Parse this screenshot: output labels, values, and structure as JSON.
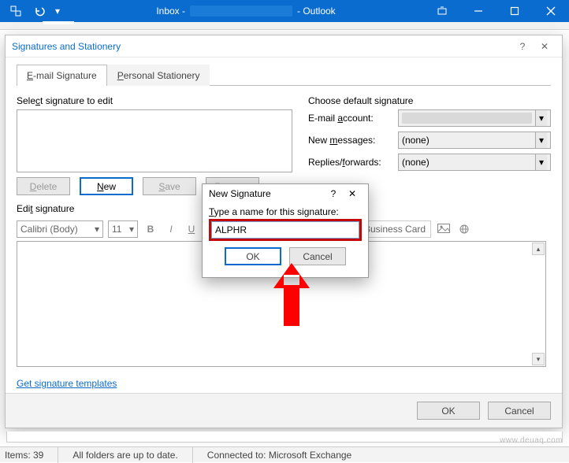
{
  "window": {
    "title_inbox": "Inbox -",
    "title_app": "- Outlook"
  },
  "dialog": {
    "title": "Signatures and Stationery",
    "tabs": {
      "email": "E-mail Signature",
      "stationery": "Personal Stationery"
    },
    "left": {
      "select_label": "Select signature to edit",
      "buttons": {
        "delete": "Delete",
        "new": "New",
        "save": "Save",
        "rename": "Rename"
      }
    },
    "right": {
      "header": "Choose default signature",
      "account_label": "E-mail account:",
      "new_msg_label": "New messages:",
      "new_msg_value": "(none)",
      "replies_label": "Replies/forwards:",
      "replies_value": "(none)"
    },
    "edit_label": "Edit signature",
    "toolbar": {
      "font": "Calibri (Body)",
      "size": "11",
      "business_card": "Business Card"
    },
    "link": "Get signature templates",
    "footer": {
      "ok": "OK",
      "cancel": "Cancel"
    }
  },
  "modal": {
    "title": "New Signature",
    "label": "Type a name for this signature:",
    "value": "ALPHR",
    "ok": "OK",
    "cancel": "Cancel",
    "help": "?",
    "close": "✕"
  },
  "status": {
    "items": "Items: 39",
    "folders": "All folders are up to date.",
    "connected": "Connected to: Microsoft Exchange"
  },
  "watermark": "www.deuaq.com"
}
